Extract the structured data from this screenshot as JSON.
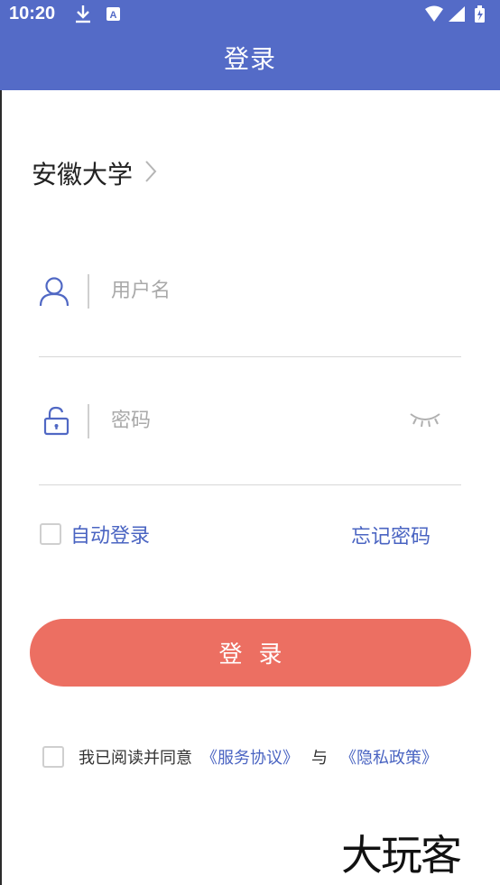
{
  "status_bar": {
    "time": "10:20",
    "icons_left": [
      "download-icon",
      "a-badge-icon"
    ],
    "icons_right": [
      "wifi-icon",
      "signal-icon",
      "battery-icon"
    ]
  },
  "header": {
    "title": "登录"
  },
  "school": {
    "name": "安徽大学",
    "chevron": "›"
  },
  "username": {
    "placeholder": "用户名",
    "value": ""
  },
  "password": {
    "placeholder": "密码",
    "value": ""
  },
  "auto_login": {
    "label": "自动登录",
    "checked": false
  },
  "forgot_password": {
    "label": "忘记密码"
  },
  "login_button": {
    "label": "登录"
  },
  "agreement": {
    "prefix": "我已阅读并同意",
    "service_link": "《服务协议》",
    "and": "与",
    "privacy_link": "《隐私政策》",
    "checked": false
  },
  "watermark": {
    "text": "大玩客"
  },
  "colors": {
    "primary": "#546bc7",
    "link": "#4a64c2",
    "login_button": "#ec6f62"
  }
}
